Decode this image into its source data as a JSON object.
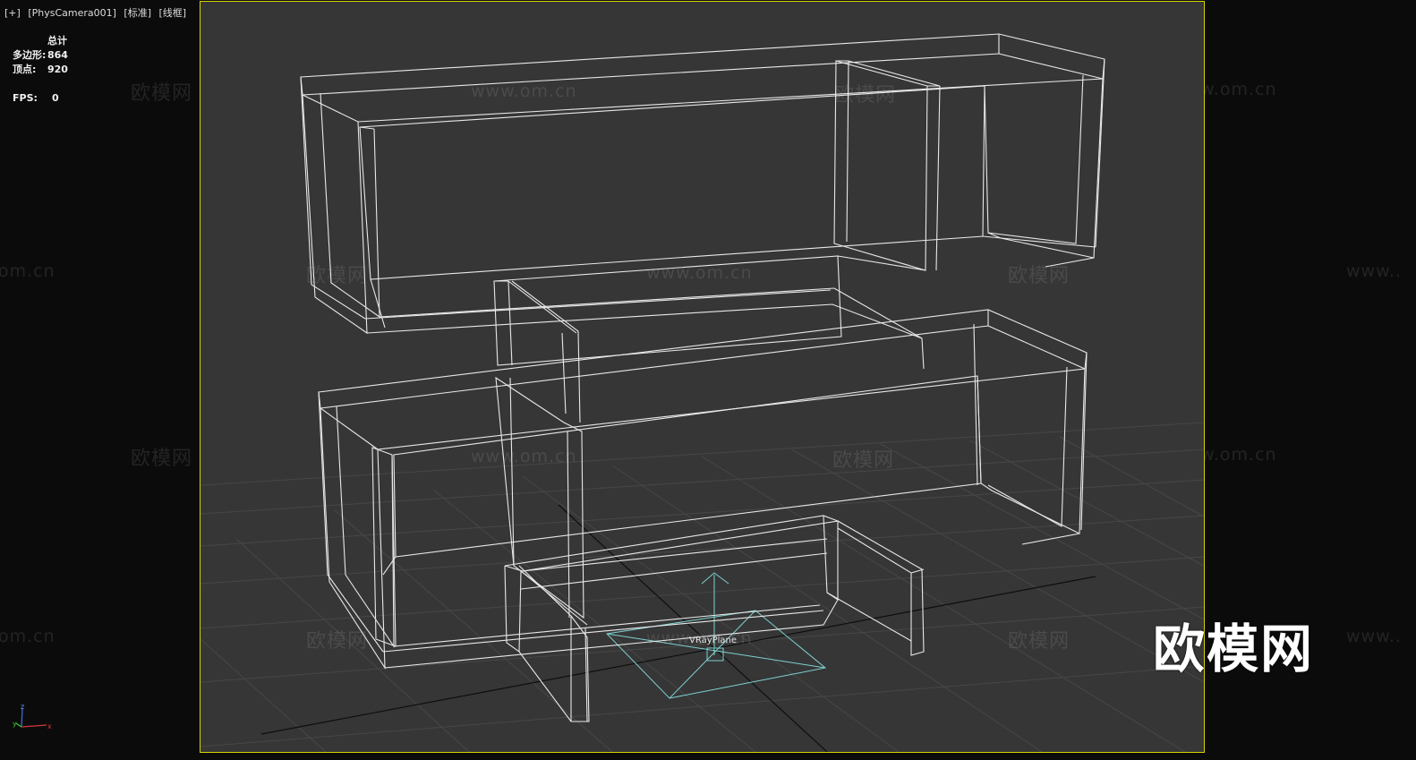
{
  "viewport": {
    "labels": [
      "[+]",
      "[PhysCamera001]",
      "[标准]",
      "[线框]"
    ],
    "border_color": "#d8d200",
    "background": "#363636"
  },
  "stats": {
    "header": "总计",
    "polygons_label": "多边形:",
    "polygons_value": "864",
    "vertices_label": "顶点:",
    "vertices_value": "920",
    "fps_label": "FPS:",
    "fps_value": "0"
  },
  "axis_gizmo": {
    "x": "x",
    "y": "y",
    "z": "z"
  },
  "scene": {
    "object_label": "VRayPlane",
    "wireframe_color": "#e8e8e8",
    "grid_color": "#474747",
    "helper_color": "#7fd0d0"
  },
  "watermark": {
    "brand": "欧模网",
    "url": "www.om.cn",
    "url_fragment": "om.cn",
    "url_prefix": "www.."
  },
  "logo_text": "欧模网"
}
